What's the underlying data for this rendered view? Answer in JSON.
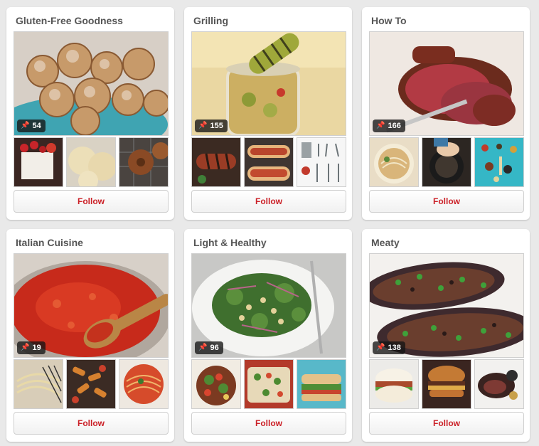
{
  "boards": [
    {
      "title": "Gluten-Free Goodness",
      "pins": "54",
      "follow_label": "Follow",
      "cover_icon": "fritters-photo",
      "thumb_icons": [
        "cake-slice-photo",
        "cookies-photo",
        "doughnut-photo"
      ]
    },
    {
      "title": "Grilling",
      "pins": "155",
      "follow_label": "Follow",
      "cover_icon": "pickle-jar-photo",
      "thumb_icons": [
        "sausage-photo",
        "hot-dog-photo",
        "grill-tools-photo"
      ]
    },
    {
      "title": "How To",
      "pins": "166",
      "follow_label": "Follow",
      "cover_icon": "roast-beef-photo",
      "thumb_icons": [
        "noodle-soup-photo",
        "cooking-pot-photo",
        "spices-photo"
      ]
    },
    {
      "title": "Italian Cuisine",
      "pins": "19",
      "follow_label": "Follow",
      "cover_icon": "tomato-sauce-photo",
      "thumb_icons": [
        "pasta-basket-photo",
        "penne-photo",
        "spaghetti-photo"
      ]
    },
    {
      "title": "Light & Healthy",
      "pins": "96",
      "follow_label": "Follow",
      "cover_icon": "kale-salad-photo",
      "thumb_icons": [
        "salad-bowl-photo",
        "quinoa-salad-photo",
        "sandwich-photo"
      ]
    },
    {
      "title": "Meaty",
      "pins": "138",
      "follow_label": "Follow",
      "cover_icon": "stuffed-eggplant-photo",
      "thumb_icons": [
        "bao-bun-photo",
        "burger-photo",
        "steak-photo"
      ]
    }
  ],
  "pin_glyph": "📌"
}
